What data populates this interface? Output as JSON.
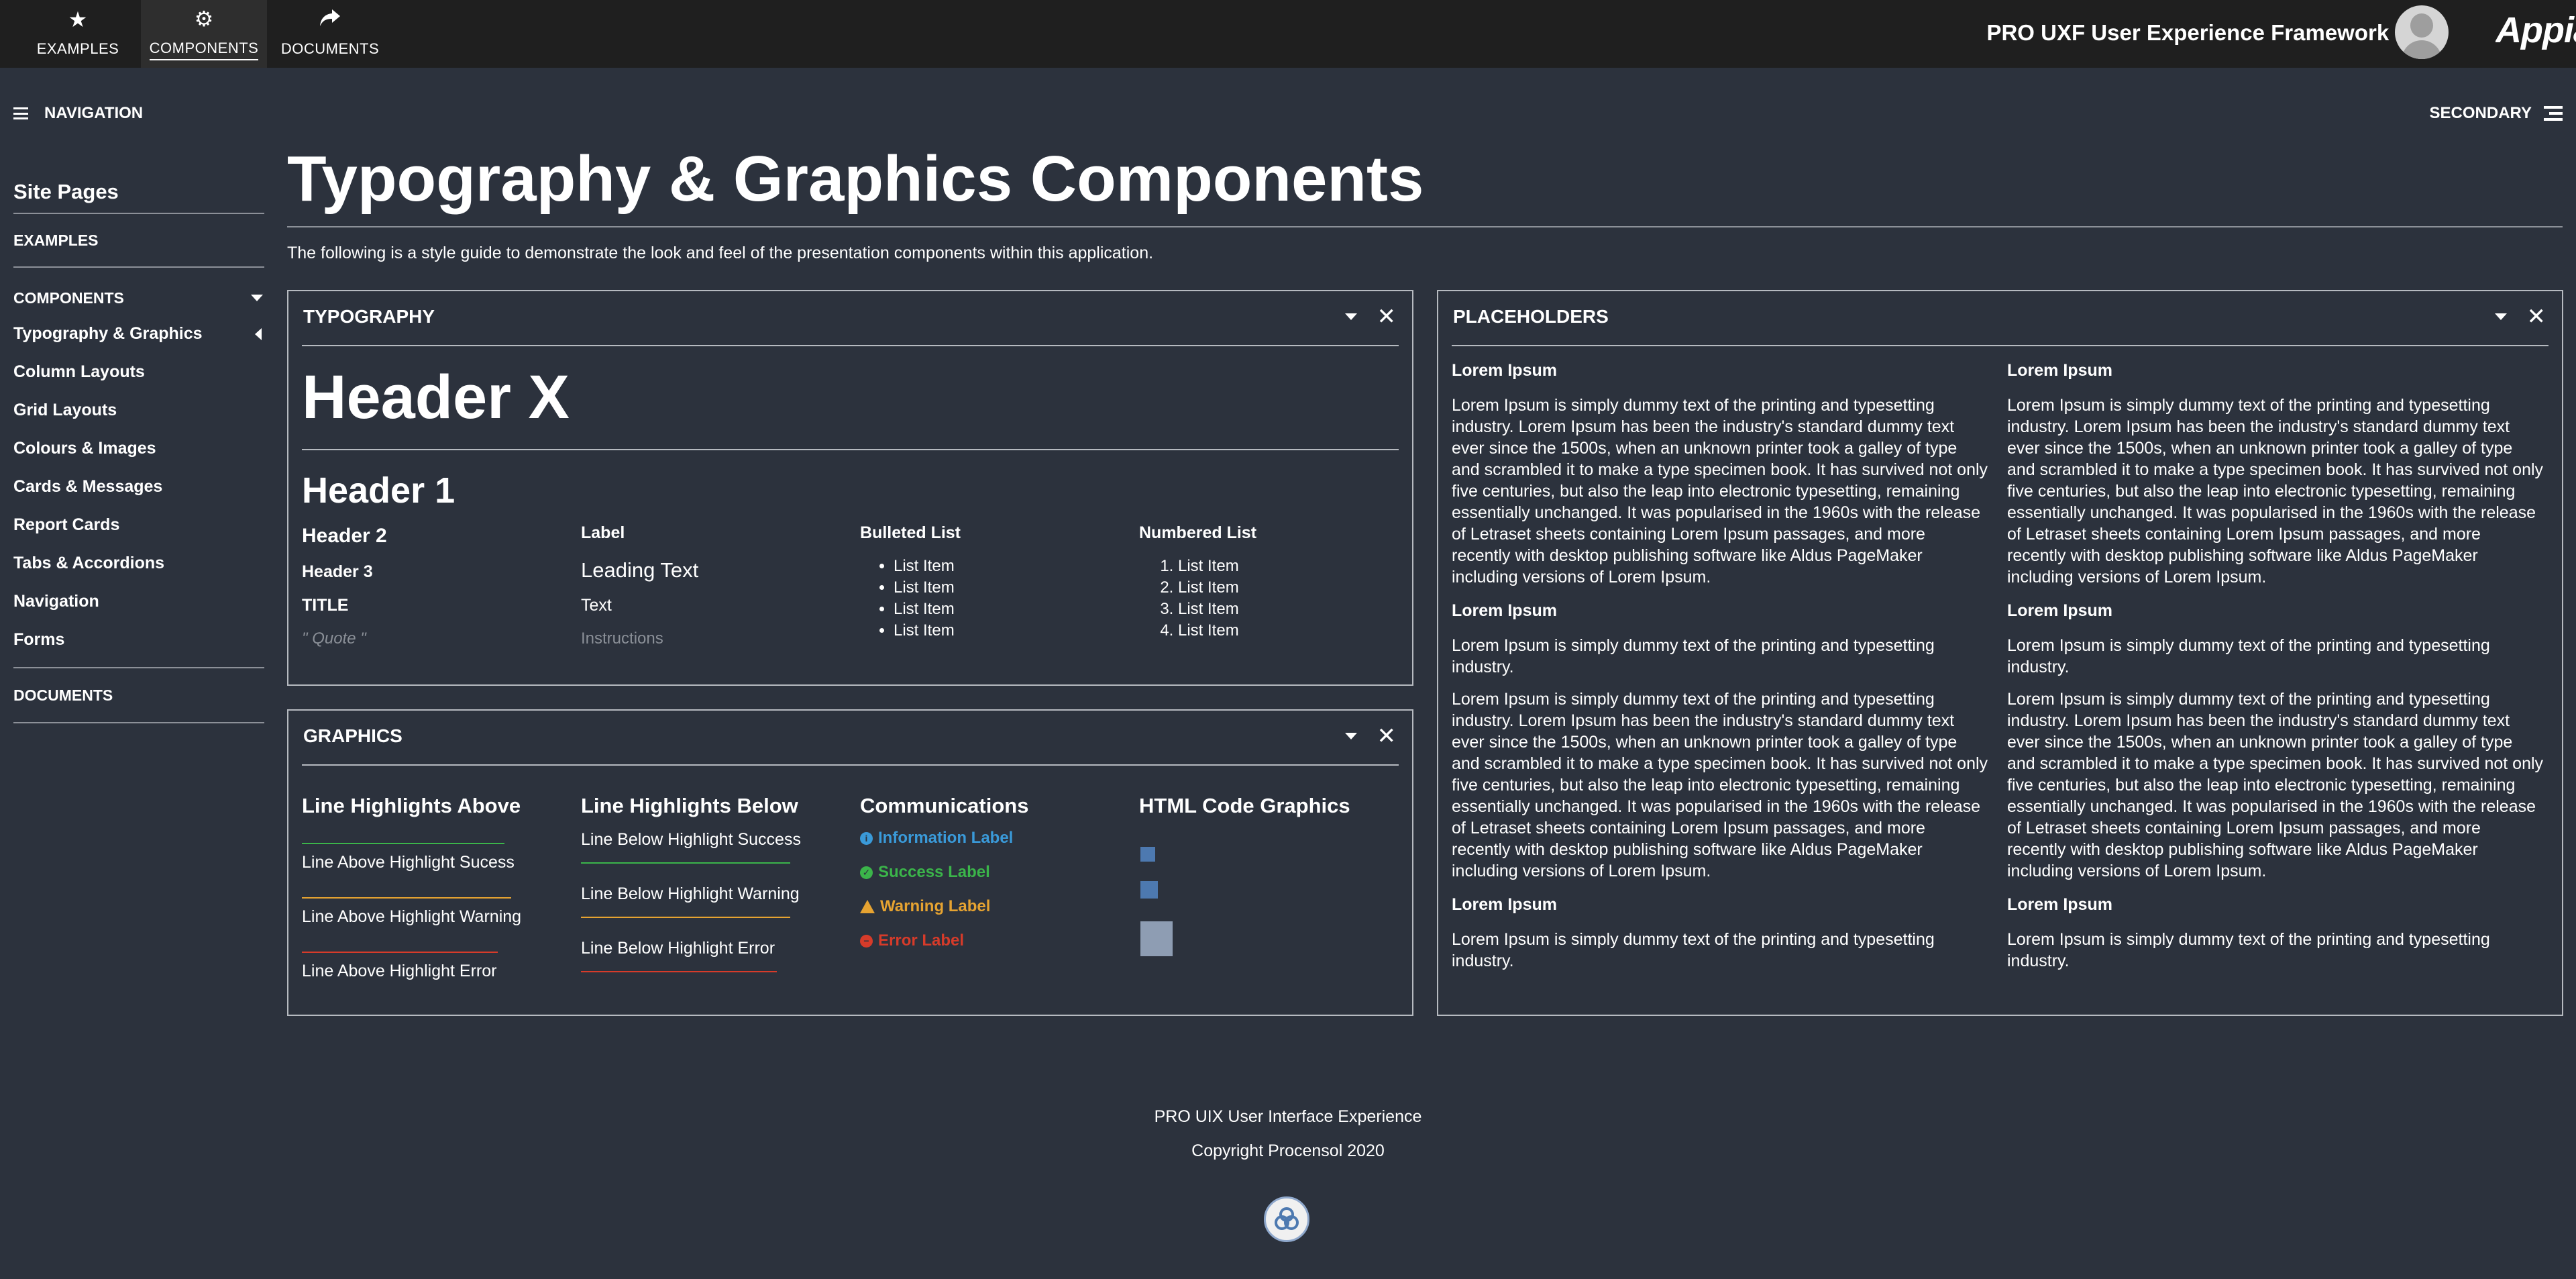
{
  "topnav": [
    {
      "label": "EXAMPLES",
      "icon": "star-icon"
    },
    {
      "label": "COMPONENTS",
      "icon": "gear-icon",
      "active": true
    },
    {
      "label": "DOCUMENTS",
      "icon": "share-icon"
    }
  ],
  "header": {
    "app_title": "PRO UXF User Experience Framework",
    "brand": "Appian"
  },
  "subheader": {
    "navigation_label": "NAVIGATION",
    "secondary_label": "SECONDARY"
  },
  "sidebar": {
    "title": "Site Pages",
    "examples": "EXAMPLES",
    "components": "COMPONENTS",
    "items": [
      "Typography & Graphics",
      "Column Layouts",
      "Grid Layouts",
      "Colours & Images",
      "Cards & Messages",
      "Report Cards",
      "Tabs & Accordions",
      "Navigation",
      "Forms"
    ],
    "active_item": "Typography & Graphics",
    "documents": "DOCUMENTS"
  },
  "main": {
    "title": "Typography & Graphics Components",
    "intro": "The following is a style guide to demonstrate the look and feel of the presentation components within this application."
  },
  "typography": {
    "panel_title": "TYPOGRAPHY",
    "header_x": "Header X",
    "header_1": "Header 1",
    "header_2": "Header 2",
    "header_3": "Header 3",
    "title": "TITLE",
    "quote": "\" Quote \"",
    "label": "Label",
    "leading_text": "Leading Text",
    "text": "Text",
    "instructions": "Instructions",
    "bulleted_title": "Bulleted List",
    "bulleted_items": [
      "List Item",
      "List Item",
      "List Item",
      "List Item"
    ],
    "numbered_title": "Numbered List",
    "numbered_items": [
      "List Item",
      "List Item",
      "List Item",
      "List Item"
    ]
  },
  "graphics": {
    "panel_title": "GRAPHICS",
    "above_title": "Line Highlights Above",
    "above_items": [
      "Line Above Highlight Sucess",
      "Line Above Highlight Warning",
      "Line Above Highlight Error"
    ],
    "below_title": "Line Highlights Below",
    "below_items": [
      "Line Below Highlight Success",
      "Line Below Highlight Warning",
      "Line Below Highlight Error"
    ],
    "comm_title": "Communications",
    "comm_items": [
      "Information Label",
      "Success Label",
      "Warning Label",
      "Error Label"
    ],
    "code_title": "HTML Code Graphics"
  },
  "placeholders": {
    "panel_title": "PLACEHOLDERS",
    "heading": "Lorem Ipsum",
    "long_text": "Lorem Ipsum is simply dummy text of the printing and typesetting industry. Lorem Ipsum has been the industry's standard dummy text ever since the 1500s, when an unknown printer took a galley of type and scrambled it to make a type specimen book. It has survived not only five centuries, but also the leap into electronic typesetting, remaining essentially unchanged. It was popularised in the 1960s with the release of Letraset sheets containing Lorem Ipsum passages, and more recently with desktop publishing software like Aldus PageMaker including versions of Lorem Ipsum.",
    "short_text": "Lorem Ipsum is simply dummy text of the printing and typesetting industry."
  },
  "footer": {
    "line1": "PRO UIX User Interface Experience",
    "line2": "Copyright Procensol 2020"
  },
  "colors": {
    "background": "#2c323d",
    "topbar": "#1f1f1f",
    "info": "#3a9ad9",
    "success": "#3bb54a",
    "warning": "#e6a331",
    "error": "#d63b2a",
    "code_graphic": "#4d79b0"
  }
}
